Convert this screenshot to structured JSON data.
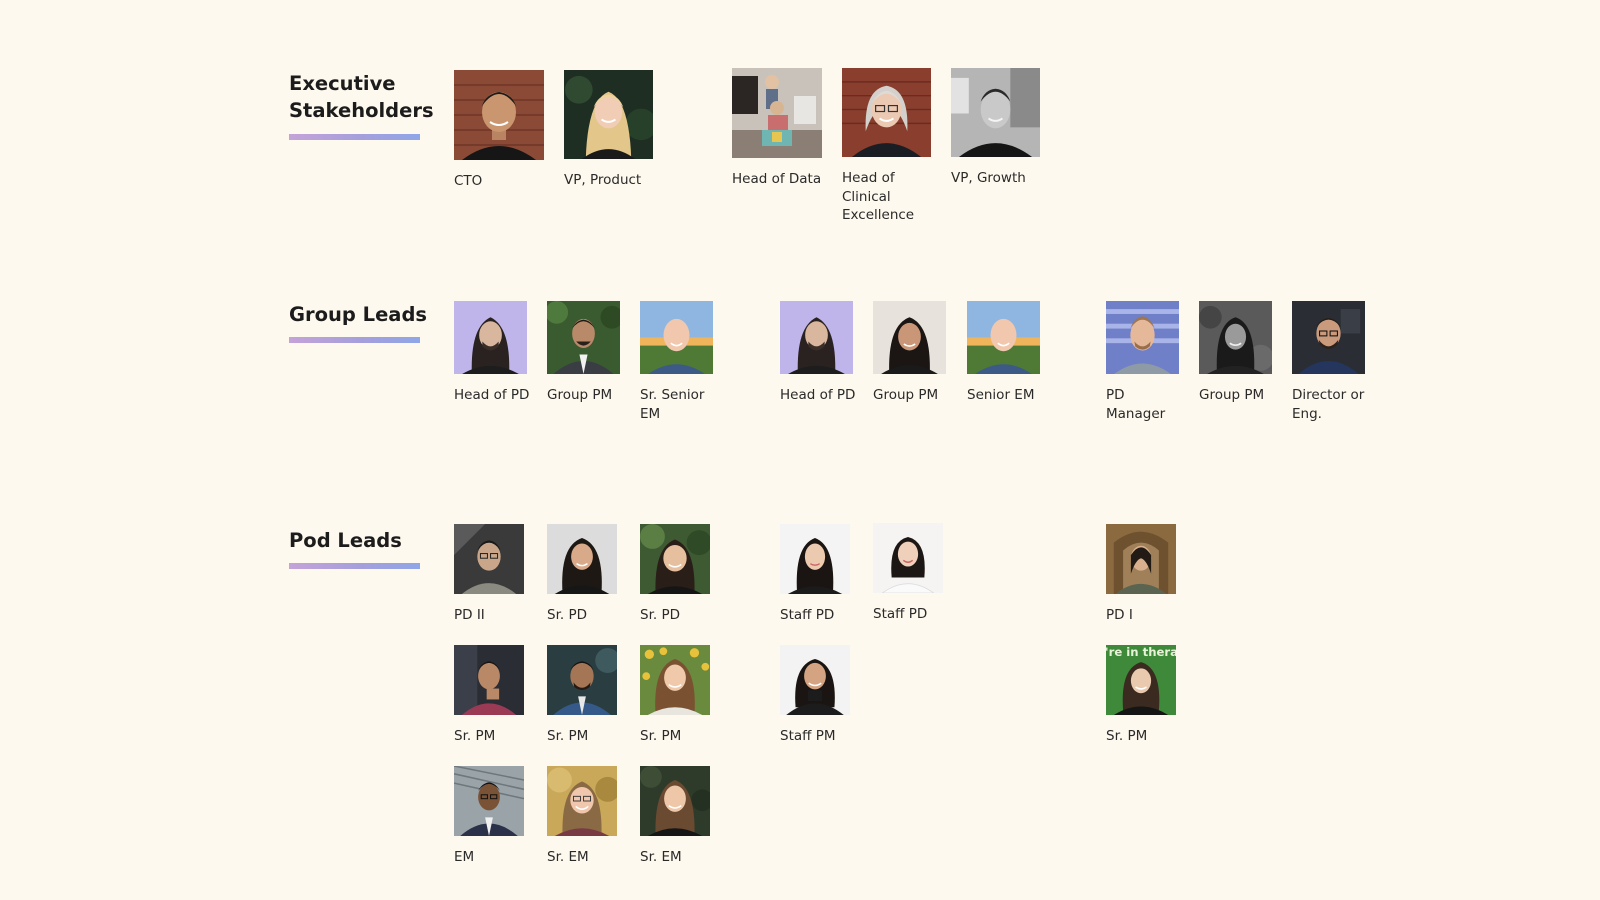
{
  "sections": {
    "executive": {
      "title": "Executive\nStakeholders",
      "people": [
        {
          "role": "CTO",
          "avatar": "cto-photo"
        },
        {
          "role": "VP, Product",
          "avatar": "vp-product-photo"
        },
        {
          "role": "Head of Data",
          "avatar": "head-of-data-photo"
        },
        {
          "role": "Head of Clinical Excellence",
          "avatar": "head-of-clinical-excellence-photo"
        },
        {
          "role": "VP, Growth",
          "avatar": "vp-growth-photo"
        }
      ]
    },
    "group_leads": {
      "title": "Group Leads",
      "people": [
        {
          "role": "Head of PD"
        },
        {
          "role": "Group PM"
        },
        {
          "role": "Sr. Senior EM"
        },
        {
          "role": "Head of PD"
        },
        {
          "role": "Group PM"
        },
        {
          "role": "Senior EM"
        },
        {
          "role": "PD Manager"
        },
        {
          "role": "Group PM"
        },
        {
          "role": "Director or Eng."
        }
      ]
    },
    "pod_leads": {
      "title": "Pod Leads",
      "people": [
        {
          "role": "PD II"
        },
        {
          "role": "Sr. PD"
        },
        {
          "role": "Sr. PD"
        },
        {
          "role": "Staff PD"
        },
        {
          "role": "Staff PD"
        },
        {
          "role": "PD I"
        },
        {
          "role": "Sr. PM"
        },
        {
          "role": "Sr. PM"
        },
        {
          "role": "Sr. PM"
        },
        {
          "role": "Staff PM"
        },
        {
          "role": "Sr. PM"
        },
        {
          "role": "EM"
        },
        {
          "role": "Sr. EM"
        },
        {
          "role": "Sr. EM"
        }
      ]
    }
  },
  "photo_text": {
    "pod_sr_pm_banner": "We're in therapy."
  },
  "colors": {
    "background": "#fef9ee",
    "accent_gradient_start": "#c4a3d8",
    "accent_gradient_end": "#8fa6e8",
    "text": "#1c1c1c"
  }
}
